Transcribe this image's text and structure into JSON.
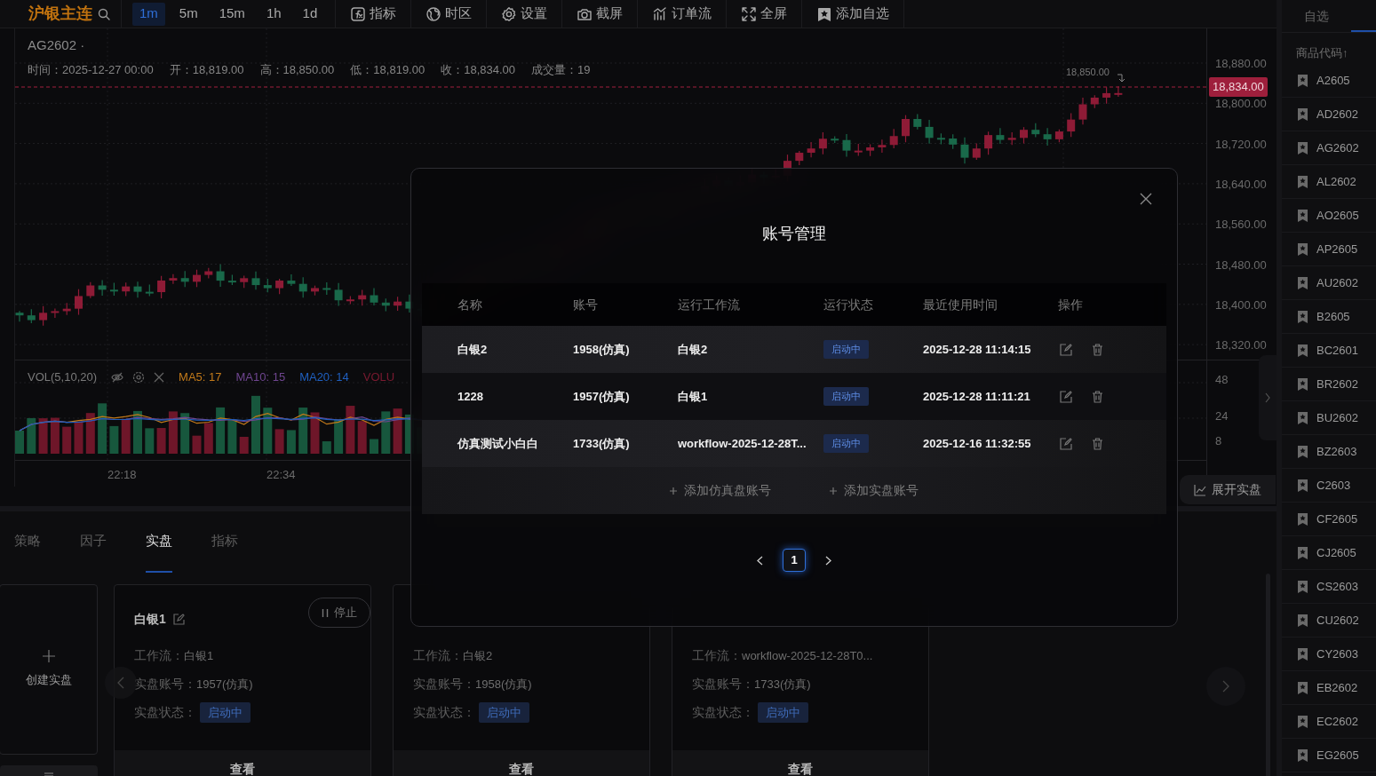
{
  "toolbar": {
    "symbol": "沪银主连",
    "timeframes": [
      {
        "label": "1m",
        "selected": true
      },
      {
        "label": "5m",
        "selected": false
      },
      {
        "label": "15m",
        "selected": false
      },
      {
        "label": "1h",
        "selected": false
      },
      {
        "label": "1d",
        "selected": false
      }
    ],
    "tools": [
      {
        "kind": "indicator",
        "label": "指标"
      },
      {
        "kind": "timezone",
        "label": "时区"
      },
      {
        "kind": "settings",
        "label": "设置"
      },
      {
        "kind": "screenshot",
        "label": "截屏"
      },
      {
        "kind": "orderflow",
        "label": "订单流"
      },
      {
        "kind": "fullscreen",
        "label": "全屏"
      },
      {
        "kind": "watchlist",
        "label": "添加自选"
      }
    ]
  },
  "chart": {
    "symbol": "AG2602 ·",
    "ohlc": [
      "时间：2025-12-27 00:00",
      "开：18,819.00",
      "高：18,850.00",
      "低：18,819.00",
      "收：18,834.00",
      "成交量：19"
    ],
    "price_ticks": [
      "18,880.00",
      "18,800.00",
      "18,720.00",
      "18,640.00",
      "18,560.00",
      "18,480.00",
      "18,400.00",
      "18,320.00"
    ],
    "current_price": "18,834.00",
    "high_marker": "18,850.00",
    "volume": {
      "title": "VOL(5,10,20)",
      "legend": [
        {
          "label": "MA5: 17",
          "color": "#c27a1a"
        },
        {
          "label": "MA10: 15",
          "color": "#6f4690"
        },
        {
          "label": "MA20: 14",
          "color": "#1f5fbf"
        },
        {
          "label": "VOLU",
          "color": "#7a1a30"
        }
      ],
      "ticks": [
        "48",
        "24",
        "8"
      ]
    },
    "time_ticks": [
      "22:18",
      "22:34"
    ]
  },
  "expand_button": "展开实盘",
  "bottom": {
    "tabs": [
      {
        "label": "策略",
        "selected": false
      },
      {
        "label": "因子",
        "selected": false
      },
      {
        "label": "实盘",
        "selected": true
      },
      {
        "label": "指标",
        "selected": false
      }
    ],
    "create_card": "创建实盘",
    "cards": [
      {
        "title": "白银1",
        "stop_label": "停止",
        "fields": [
          {
            "label": "工作流：",
            "value": "白银1"
          },
          {
            "label": "实盘账号：",
            "value": "1957(仿真)"
          },
          {
            "label": "实盘状态：",
            "value": "启动中",
            "kind": "badge"
          }
        ],
        "view": "查看"
      },
      {
        "fields": [
          {
            "label": "工作流：",
            "value": "白银2"
          },
          {
            "label": "实盘账号：",
            "value": "1958(仿真)"
          },
          {
            "label": "实盘状态：",
            "value": "启动中",
            "kind": "badge"
          }
        ],
        "view": "查看"
      },
      {
        "fields": [
          {
            "label": "工作流：",
            "value": "workflow-2025-12-28T0..."
          },
          {
            "label": "实盘账号：",
            "value": "1733(仿真)"
          },
          {
            "label": "实盘状态：",
            "value": "启动中",
            "kind": "badge"
          }
        ],
        "view": "查看"
      }
    ]
  },
  "sidebar": {
    "tabs": [
      {
        "label": "自选",
        "selected": false
      }
    ],
    "header": "商品代码↑",
    "items": [
      "A2605",
      "AD2602",
      "AG2602",
      "AL2602",
      "AO2605",
      "AP2605",
      "AU2602",
      "B2605",
      "BC2601",
      "BR2602",
      "BU2602",
      "BZ2603",
      "C2603",
      "CF2605",
      "CJ2605",
      "CS2603",
      "CU2602",
      "CY2603",
      "EB2602",
      "EC2602",
      "EG2605"
    ]
  },
  "modal": {
    "title": "账号管理",
    "columns": [
      "名称",
      "账号",
      "运行工作流",
      "运行状态",
      "最近使用时间",
      "操作"
    ],
    "rows": [
      {
        "name": "白银2",
        "account": "1958(仿真)",
        "workflow": "白银2",
        "status": "启动中",
        "last_used": "2025-12-28 11:14:15"
      },
      {
        "name": "1228",
        "account": "1957(仿真)",
        "workflow": "白银1",
        "status": "启动中",
        "last_used": "2025-12-28 11:11:21"
      },
      {
        "name": "仿真测试小白白",
        "account": "1733(仿真)",
        "workflow": "workflow-2025-12-28T...",
        "status": "启动中",
        "last_used": "2025-12-16 11:32:55"
      }
    ],
    "add_links": [
      "添加仿真盘账号",
      "添加实盘账号"
    ],
    "pages": [
      {
        "label": "1",
        "selected": true
      }
    ]
  }
}
